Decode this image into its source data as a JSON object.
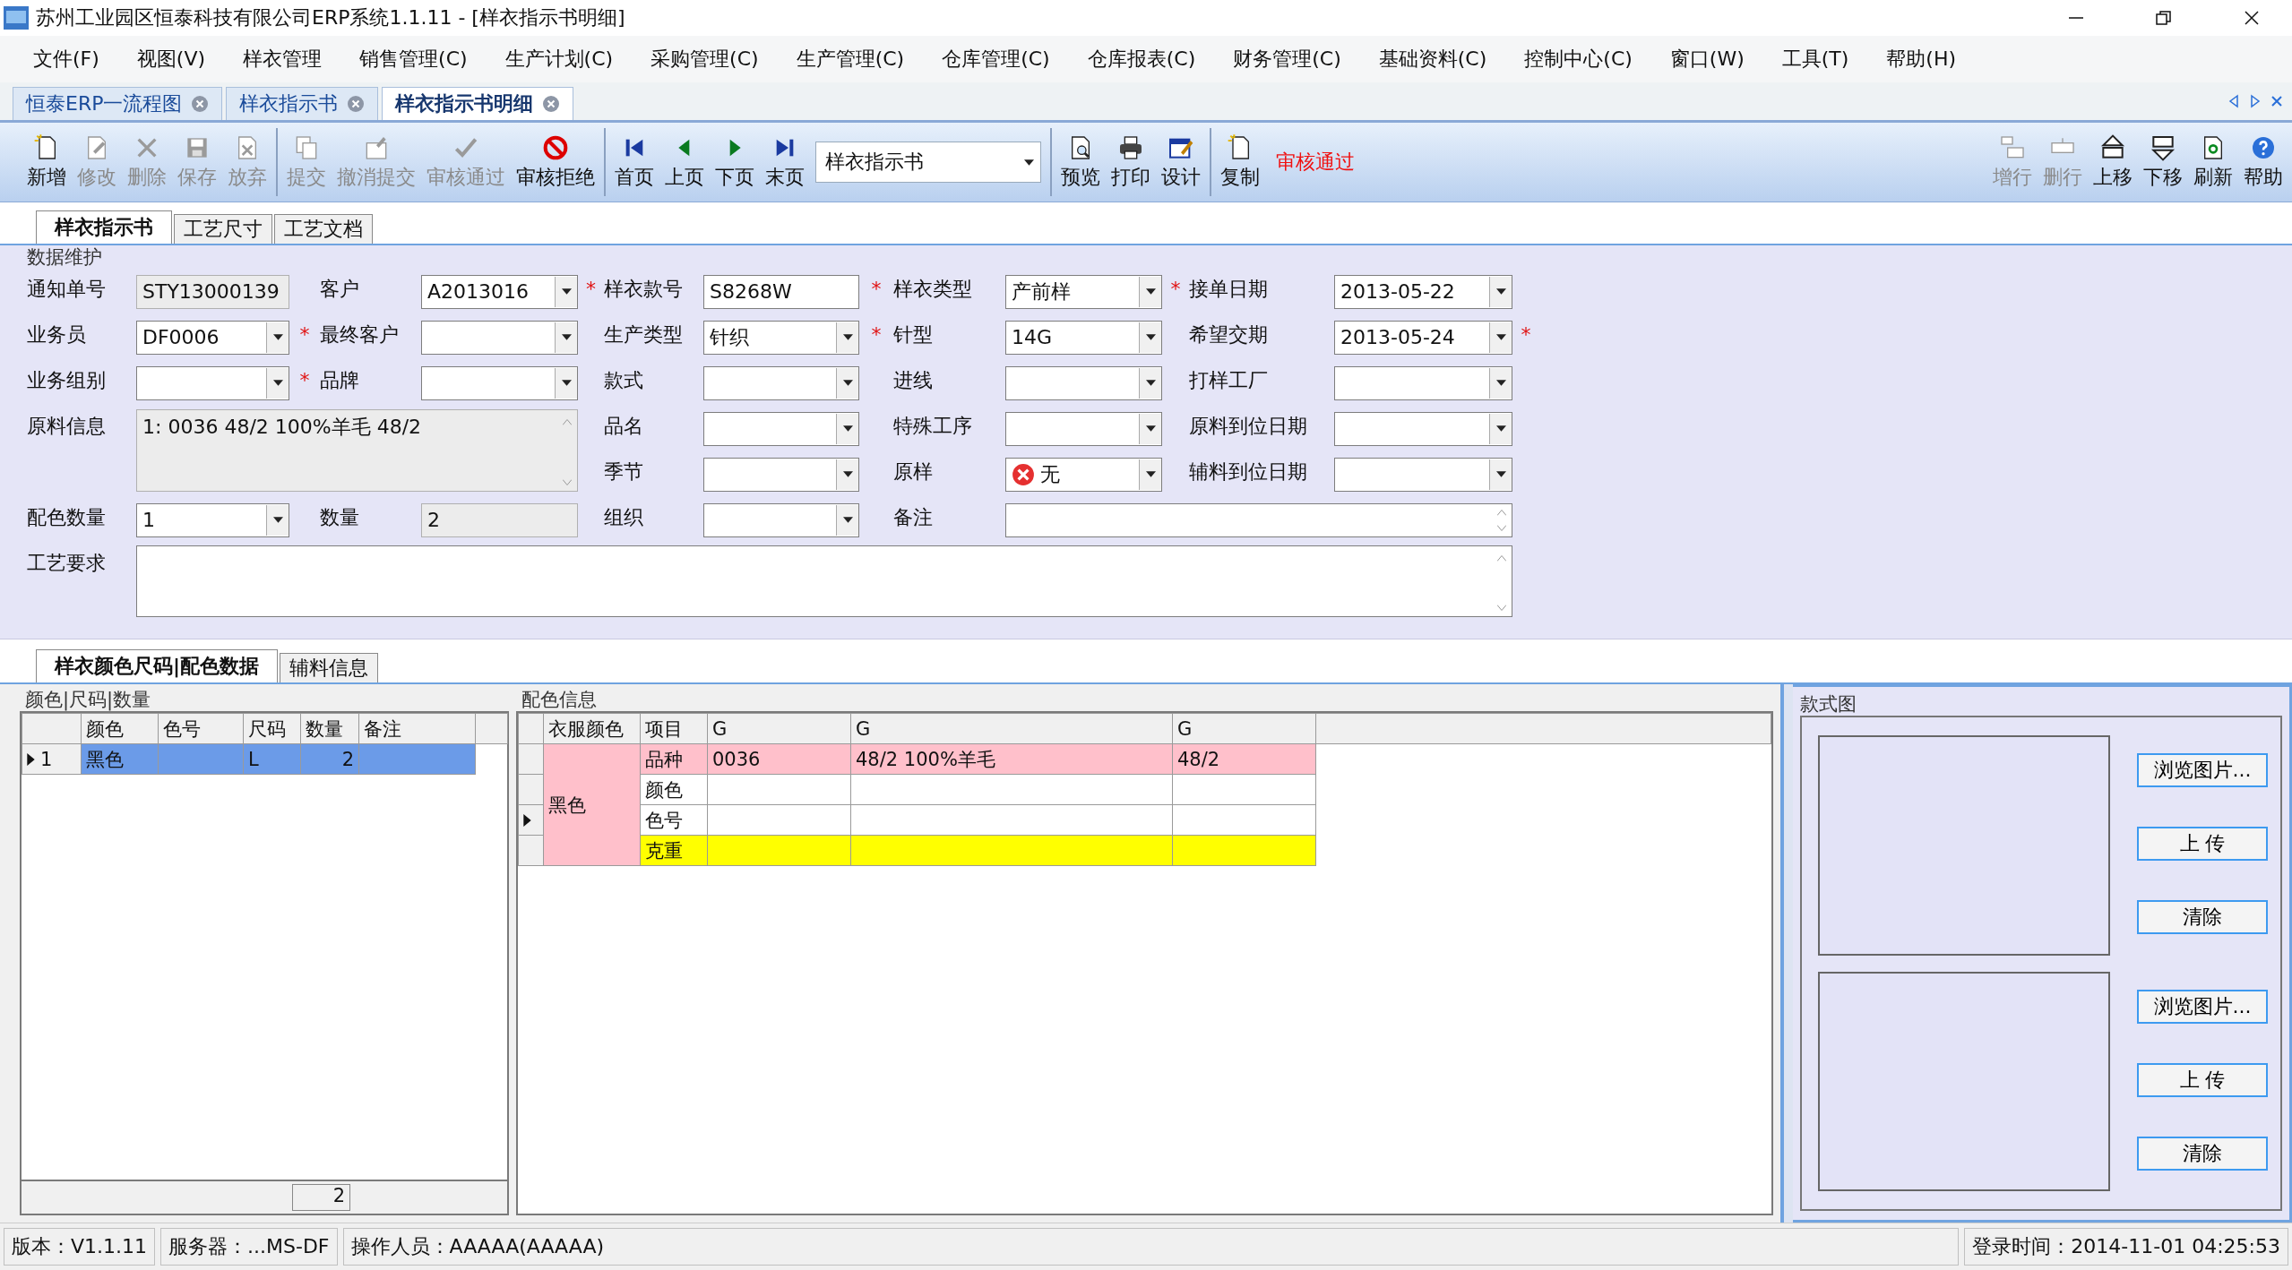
{
  "window": {
    "title": "苏州工业园区恒泰科技有限公司ERP系统1.1.11 - [样衣指示书明细]"
  },
  "menu": [
    "文件(F)",
    "视图(V)",
    "样衣管理",
    "销售管理(C)",
    "生产计划(C)",
    "采购管理(C)",
    "生产管理(C)",
    "仓库管理(C)",
    "仓库报表(C)",
    "财务管理(C)",
    "基础资料(C)",
    "控制中心(C)",
    "窗口(W)",
    "工具(T)",
    "帮助(H)"
  ],
  "document_tabs": [
    {
      "label": "恒泰ERP一流程图",
      "selected": false
    },
    {
      "label": "样衣指示书",
      "selected": false
    },
    {
      "label": "样衣指示书明细",
      "selected": true
    }
  ],
  "toolbar": {
    "groups": [
      {
        "items": [
          {
            "kind": "button",
            "label": "新增",
            "disabled": false
          },
          {
            "kind": "button",
            "label": "修改",
            "disabled": true
          },
          {
            "kind": "button",
            "label": "删除",
            "disabled": true
          },
          {
            "kind": "button",
            "label": "保存",
            "disabled": true
          },
          {
            "kind": "button",
            "label": "放弃",
            "disabled": true
          }
        ]
      },
      {
        "items": [
          {
            "kind": "button",
            "label": "提交",
            "disabled": true
          },
          {
            "kind": "button",
            "label": "撤消提交",
            "disabled": true
          },
          {
            "kind": "button",
            "label": "审核通过",
            "disabled": true
          },
          {
            "kind": "button",
            "label": "审核拒绝",
            "disabled": false
          }
        ]
      },
      {
        "items": [
          {
            "kind": "button",
            "label": "首页",
            "disabled": false
          },
          {
            "kind": "button",
            "label": "上页",
            "disabled": false
          },
          {
            "kind": "button",
            "label": "下页",
            "disabled": false
          },
          {
            "kind": "button",
            "label": "末页",
            "disabled": false
          },
          {
            "kind": "select",
            "value": "样衣指示书"
          }
        ]
      },
      {
        "items": [
          {
            "kind": "button",
            "label": "预览",
            "disabled": false
          },
          {
            "kind": "button",
            "label": "打印",
            "disabled": false
          },
          {
            "kind": "button",
            "label": "设计",
            "disabled": false
          }
        ]
      },
      {
        "items": [
          {
            "kind": "button",
            "label": "复制",
            "disabled": false
          },
          {
            "kind": "status",
            "label": "审核通过"
          }
        ]
      }
    ],
    "right_items": [
      {
        "kind": "button",
        "label": "增行",
        "disabled": true
      },
      {
        "kind": "button",
        "label": "删行",
        "disabled": true
      },
      {
        "kind": "button",
        "label": "上移",
        "disabled": false
      },
      {
        "kind": "button",
        "label": "下移",
        "disabled": false
      },
      {
        "kind": "button",
        "label": "刷新",
        "disabled": false
      },
      {
        "kind": "button",
        "label": "帮助",
        "disabled": false
      }
    ]
  },
  "form_tabs": [
    {
      "label": "样衣指示书",
      "selected": true
    },
    {
      "label": "工艺尺寸",
      "selected": false
    },
    {
      "label": "工艺文档",
      "selected": false
    }
  ],
  "form": {
    "title": "数据维护",
    "rows": [
      [
        {
          "label": "通知单号",
          "kind": "text",
          "value": "STY13000139",
          "disabled": true
        },
        {
          "label": "客户",
          "kind": "combo",
          "value": "A2013016",
          "required_mark": "*"
        },
        {
          "label": "样衣款号",
          "kind": "text",
          "value": "S8268W",
          "required_mark": "*"
        },
        {
          "label": "样衣类型",
          "kind": "combo",
          "value": "产前样",
          "required_mark": "*"
        },
        {
          "label": "接单日期",
          "kind": "combo",
          "value": "2013-05-22"
        }
      ],
      [
        {
          "label": "业务员",
          "kind": "combo",
          "value": "DF0006",
          "required_mark": "*"
        },
        {
          "label": "最终客户",
          "kind": "combo"
        },
        {
          "label": "生产类型",
          "kind": "combo",
          "value": "针织",
          "required_mark": "*"
        },
        {
          "label": "针型",
          "kind": "combo",
          "value": "14G"
        },
        {
          "label": "希望交期",
          "kind": "combo",
          "value": "2013-05-24",
          "required_mark": "*"
        }
      ],
      [
        {
          "label": "业务组别",
          "kind": "combo",
          "required_mark": "*"
        },
        {
          "label": "品牌",
          "kind": "combo"
        },
        {
          "label": "款式",
          "kind": "combo"
        },
        {
          "label": "进线",
          "kind": "combo"
        },
        {
          "label": "打样工厂",
          "kind": "combo"
        }
      ],
      [
        {
          "label": "原料信息",
          "kind": "memo",
          "value": "1: 0036 48/2 100%羊毛 48/2",
          "disabled": true
        },
        "",
        {
          "label": "品名",
          "kind": "combo"
        },
        {
          "label": "特殊工序",
          "kind": "combo"
        },
        {
          "label": "原料到位日期",
          "kind": "combo"
        }
      ],
      [
        "",
        "",
        {
          "label": "季节",
          "kind": "combo"
        },
        {
          "label": "原样",
          "kind": "flag_combo",
          "value": "无"
        },
        {
          "label": "辅料到位日期",
          "kind": "combo"
        }
      ],
      [
        {
          "label": "配色数量",
          "kind": "combo",
          "value": "1"
        },
        {
          "label": "数量",
          "kind": "text",
          "value": "2",
          "disabled": true
        },
        {
          "label": "组织",
          "kind": "combo"
        },
        {
          "label": "备注",
          "kind": "remark"
        }
      ],
      [
        {
          "label": "工艺要求",
          "kind": "longtext"
        }
      ]
    ]
  },
  "detail_tabs": [
    {
      "label": "样衣颜色尺码|配色数据",
      "selected": true
    },
    {
      "label": "辅料信息",
      "selected": false
    }
  ],
  "size_grid": {
    "title": "颜色|尺码|数量",
    "columns": [
      "颜色",
      "色号",
      "尺码",
      "数量",
      "备注"
    ],
    "rows": [
      {
        "number": "1",
        "current": true,
        "selected": true,
        "cells": {
          "shade": "黑色",
          "size": "L",
          "quantity": "2"
        }
      }
    ],
    "total": "2"
  },
  "color_grid": {
    "title": "配色信息",
    "columns": [
      "衣服颜色",
      "项目",
      "G",
      "G",
      "G"
    ],
    "groups": [
      {
        "name": "黑色",
        "color": "#ffc0cb",
        "rows": [
          {
            "item": "品种",
            "color": "#ffc0cb",
            "current": false,
            "values": [
              "0036",
              "48/2 100%羊毛",
              "48/2"
            ]
          },
          {
            "item": "颜色",
            "color": "#ffffff",
            "current": false
          },
          {
            "item": "色号",
            "color": "#ffffff",
            "current": true
          },
          {
            "item": "克重",
            "color": "#ffff00",
            "current": false
          }
        ]
      }
    ]
  },
  "style_images": {
    "title": "款式图",
    "slots": [
      {
        "buttons": [
          "浏览图片...",
          "上 传",
          "清除"
        ]
      },
      {
        "buttons": [
          "浏览图片...",
          "上 传",
          "清除"
        ]
      }
    ]
  },
  "status_bar": [
    "版本：V1.1.11",
    "服务器：...MS-DF",
    "操作人员：AAAAA(AAAAA)",
    "登录时间：2014-11-01 04:25:53"
  ]
}
